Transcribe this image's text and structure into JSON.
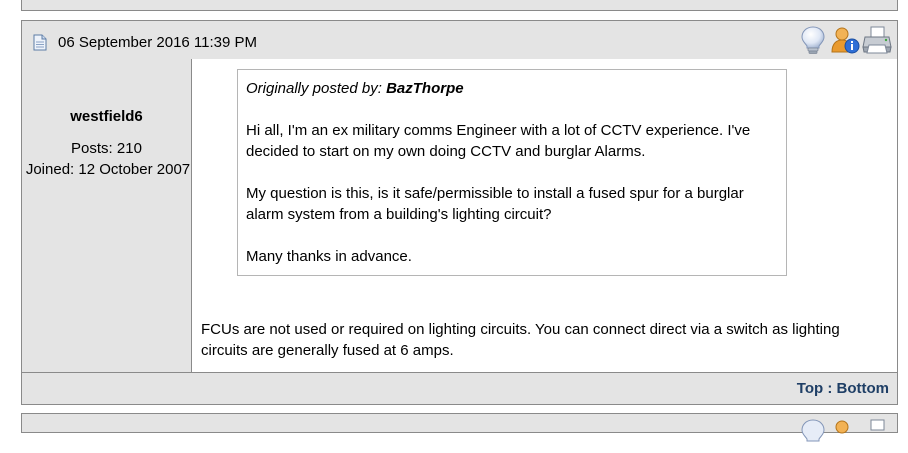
{
  "post": {
    "date": "06 September 2016 11:39 PM",
    "icons": [
      "document-icon",
      "lightbulb-icon",
      "user-info-icon",
      "printer-icon"
    ]
  },
  "user": {
    "name": "westfield6",
    "posts": "Posts: 210",
    "joined": "Joined: 12 October 2007"
  },
  "quote": {
    "prefix": "Originally posted by: ",
    "author": "BazThorpe",
    "paragraphs": [
      "Hi all, I'm an ex military comms Engineer with a lot of CCTV experience. I've decided to start on my own doing CCTV and burglar Alarms.",
      "My question is this, is it safe/permissible to install a fused spur for a burglar alarm system from a building's lighting circuit?",
      "Many thanks in advance."
    ]
  },
  "reply": {
    "text": "FCUs are not used or required on lighting circuits. You can connect direct via a switch as lighting circuits are generally fused at 6 amps."
  },
  "footer": {
    "top": "Top",
    "separator": " : ",
    "bottom": "Bottom"
  }
}
